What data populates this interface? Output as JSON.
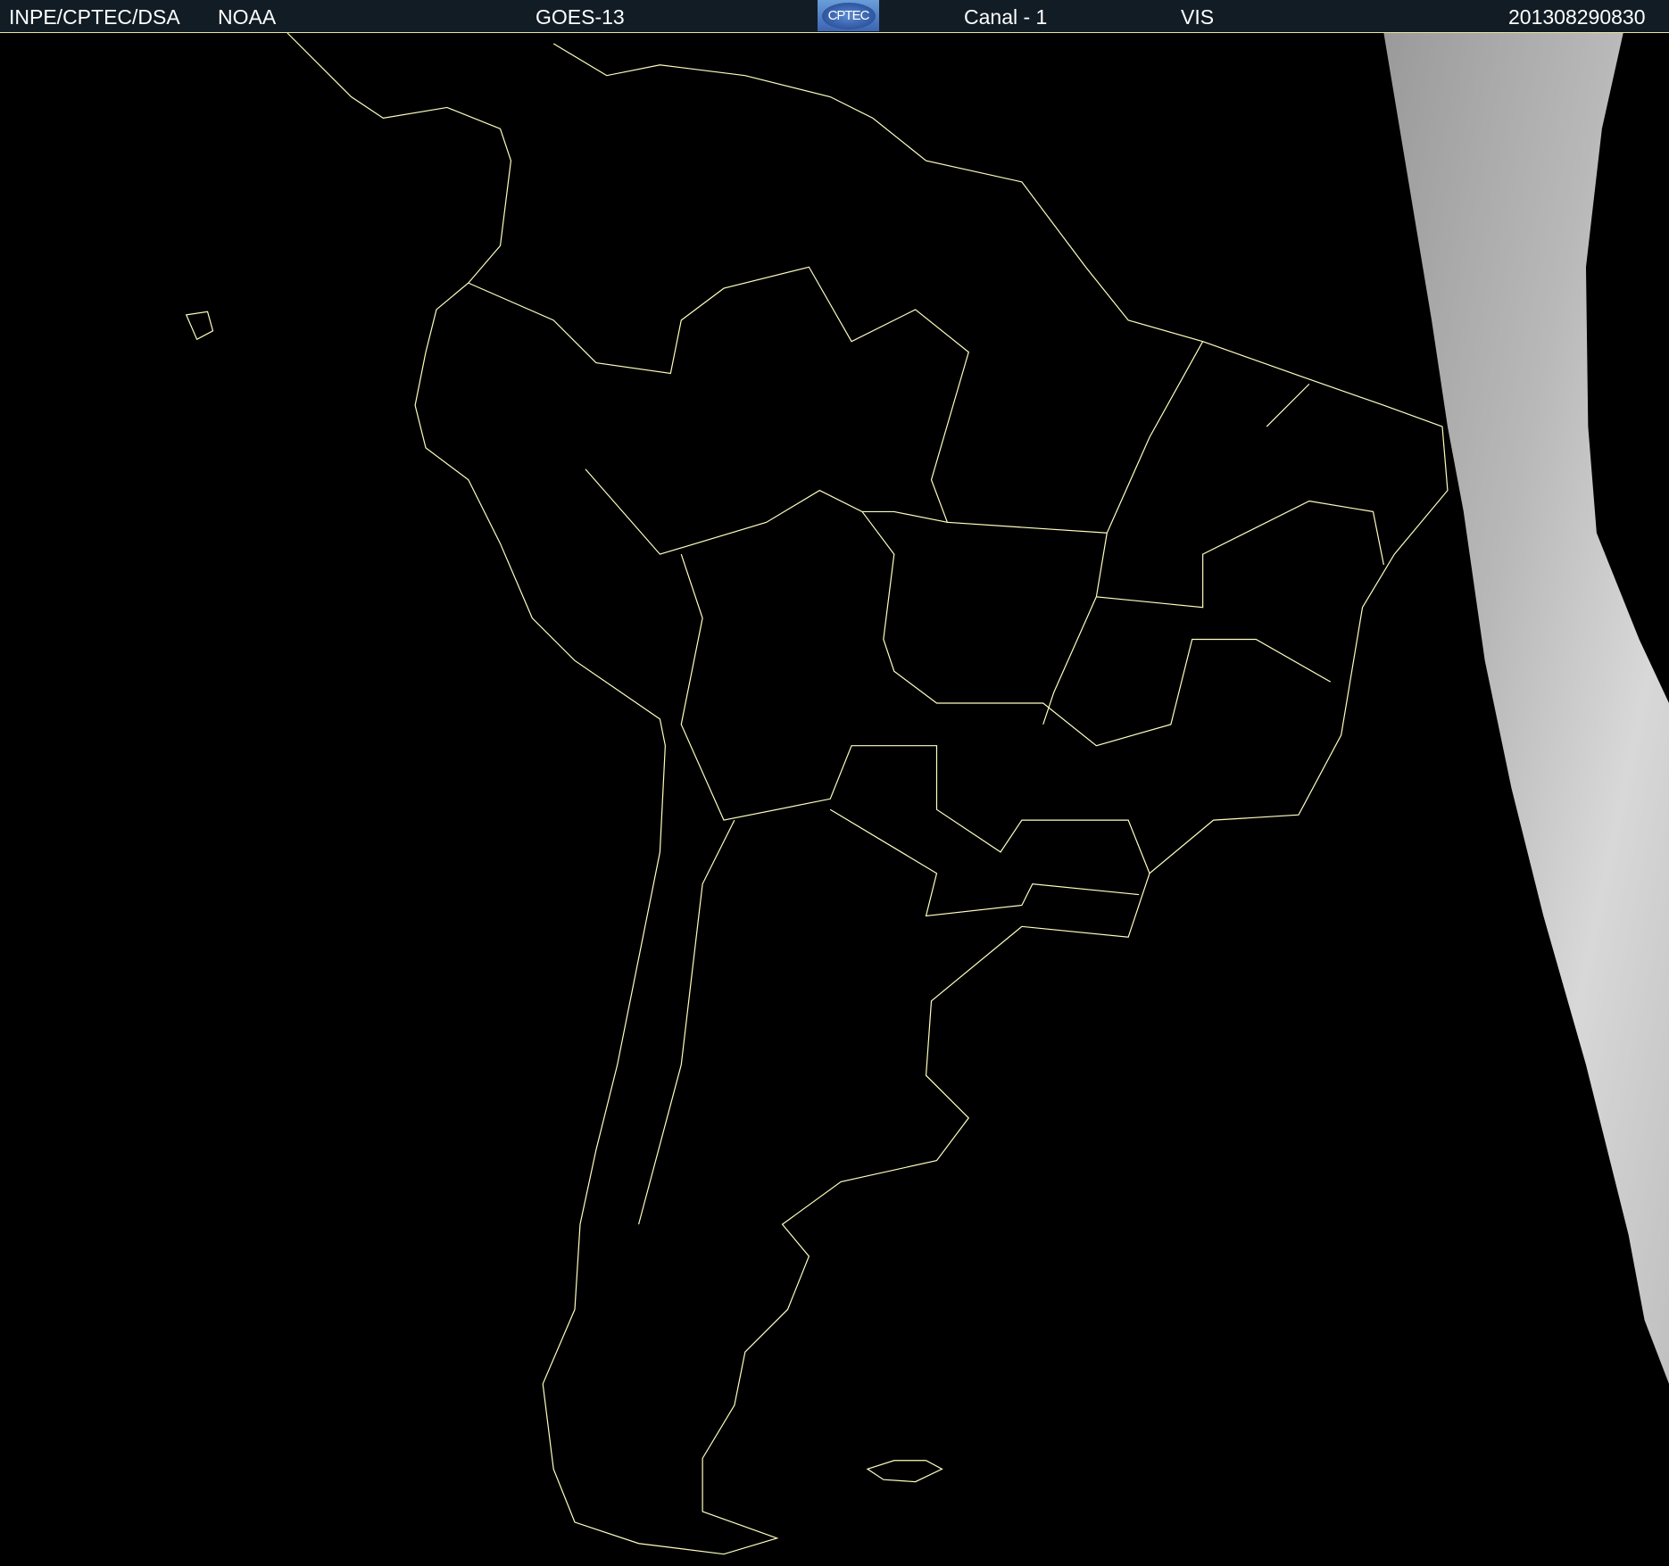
{
  "header": {
    "institution": "INPE/CPTEC/DSA",
    "agency": "NOAA",
    "satellite": "GOES-13",
    "logo_text": "CPTEC",
    "channel": "Canal - 1",
    "band": "VIS",
    "timestamp": "201308290830"
  },
  "colors": {
    "header_bg": "#121c25",
    "coastline": "#ffffc0",
    "background": "#000000"
  }
}
